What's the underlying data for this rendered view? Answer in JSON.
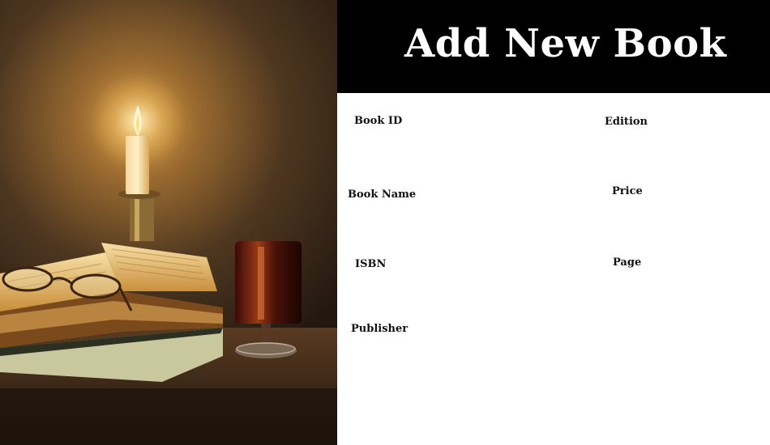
{
  "window": {
    "title": "Add New Book"
  },
  "colors": {
    "header_bg": "#000000",
    "title_text": "#ffffff",
    "form_bg": "#ffffff",
    "label_text": "#111111"
  },
  "image": {
    "name": "candle-and-books-illustration"
  },
  "form": {
    "fields": {
      "book_id": {
        "label": "Book ID",
        "value": ""
      },
      "book_name": {
        "label": "Book Name",
        "value": ""
      },
      "isbn": {
        "label": "ISBN",
        "value": ""
      },
      "publisher": {
        "label": "Publisher",
        "value": ""
      },
      "edition": {
        "label": "Edition",
        "value": ""
      },
      "price": {
        "label": "Price",
        "value": ""
      },
      "page": {
        "label": "Page",
        "value": ""
      }
    }
  }
}
